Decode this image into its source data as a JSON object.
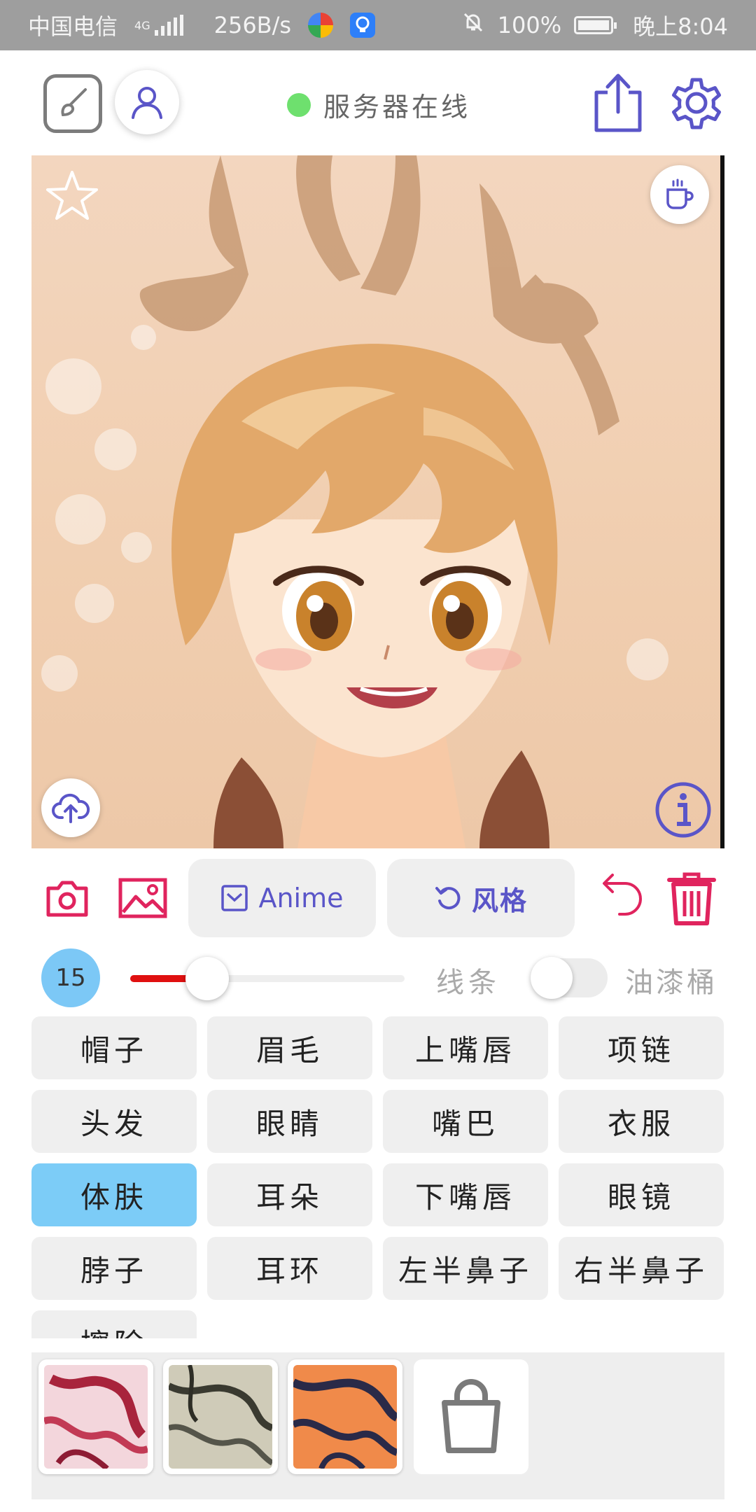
{
  "status_bar": {
    "carrier": "中国电信",
    "network": "4G",
    "speed": "256B/s",
    "battery": "100%",
    "battery_level": 1.0,
    "time": "晚上8:04"
  },
  "header": {
    "server_status": "服务器在线",
    "server_status_color": "#6ee06e"
  },
  "canvas": {
    "image_icon_names": [
      "star-icon",
      "coffee-cup-icon",
      "cloud-upload-icon",
      "info-icon"
    ]
  },
  "toolbar": {
    "anime_label": "Anime",
    "style_label": "风格",
    "accent_color": "#5a55c8",
    "danger_color": "#e0245e"
  },
  "brush": {
    "size": "15",
    "slider_value": 0.28,
    "lines_label": "线条",
    "bucket_label": "油漆桶",
    "bucket_enabled": false
  },
  "parts": [
    {
      "label": "帽子",
      "selected": false
    },
    {
      "label": "眉毛",
      "selected": false
    },
    {
      "label": "上嘴唇",
      "selected": false
    },
    {
      "label": "项链",
      "selected": false
    },
    {
      "label": "头发",
      "selected": false
    },
    {
      "label": "眼睛",
      "selected": false
    },
    {
      "label": "嘴巴",
      "selected": false
    },
    {
      "label": "衣服",
      "selected": false
    },
    {
      "label": "体肤",
      "selected": true
    },
    {
      "label": "耳朵",
      "selected": false
    },
    {
      "label": "下嘴唇",
      "selected": false
    },
    {
      "label": "眼镜",
      "selected": false
    },
    {
      "label": "脖子",
      "selected": false
    },
    {
      "label": "耳环",
      "selected": false
    },
    {
      "label": "左半鼻子",
      "selected": false
    },
    {
      "label": "右半鼻子",
      "selected": false
    },
    {
      "label": "擦除",
      "selected": false
    }
  ],
  "textures": [
    {
      "name": "pink-marble-texture",
      "colors": [
        "#f3d6dc",
        "#a8243c"
      ]
    },
    {
      "name": "gray-marble-texture",
      "colors": [
        "#cfcbb8",
        "#3a3a30"
      ]
    },
    {
      "name": "orange-marble-texture",
      "colors": [
        "#f08a4a",
        "#2a2a48"
      ]
    }
  ]
}
